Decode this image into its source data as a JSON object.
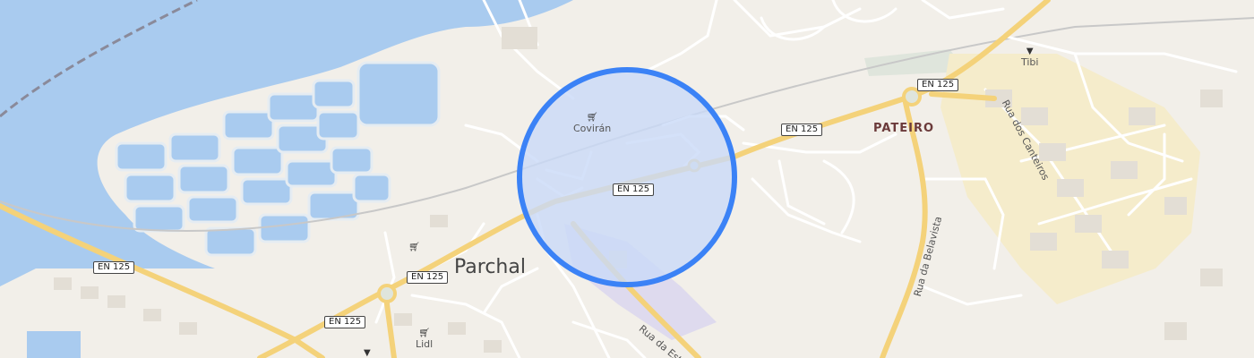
{
  "map": {
    "place_labels": {
      "parchal": "Parchal",
      "pateiro": "PATEIRO"
    },
    "road_shields": {
      "en125_west": "EN 125",
      "en125_south": "EN 125",
      "en125_parchal": "EN 125",
      "en125_center": "EN 125",
      "en125_east": "EN 125",
      "en125_northeast": "EN 125"
    },
    "street_labels": {
      "rua_dos_canteiros": "Rua dos Canteiros",
      "rua_da_belavista": "Rua da Belavista",
      "rua_da_est": "Rua da Est"
    },
    "pois": {
      "coviran": {
        "name": "Covirán",
        "icon": "shopping-cart-icon"
      },
      "tibi": {
        "name": "Tibi",
        "icon": "shopping-basket-icon"
      },
      "lidl": {
        "name": "Lidl",
        "icon": "shopping-cart-icon"
      },
      "shop_unnamed": {
        "icon": "shopping-cart-icon"
      },
      "shop_bottom": {
        "icon": "shopping-basket-icon"
      }
    },
    "accuracy_circle": {
      "color": "#3b82f6",
      "fill": "#c9d9f7"
    },
    "colors": {
      "land": "#f2efe9",
      "water": "#a9cbef",
      "major_road": "#f4d27a",
      "minor_road": "#ffffff",
      "urban_area": "#f5eccb",
      "park": "#dfe5dc"
    }
  }
}
